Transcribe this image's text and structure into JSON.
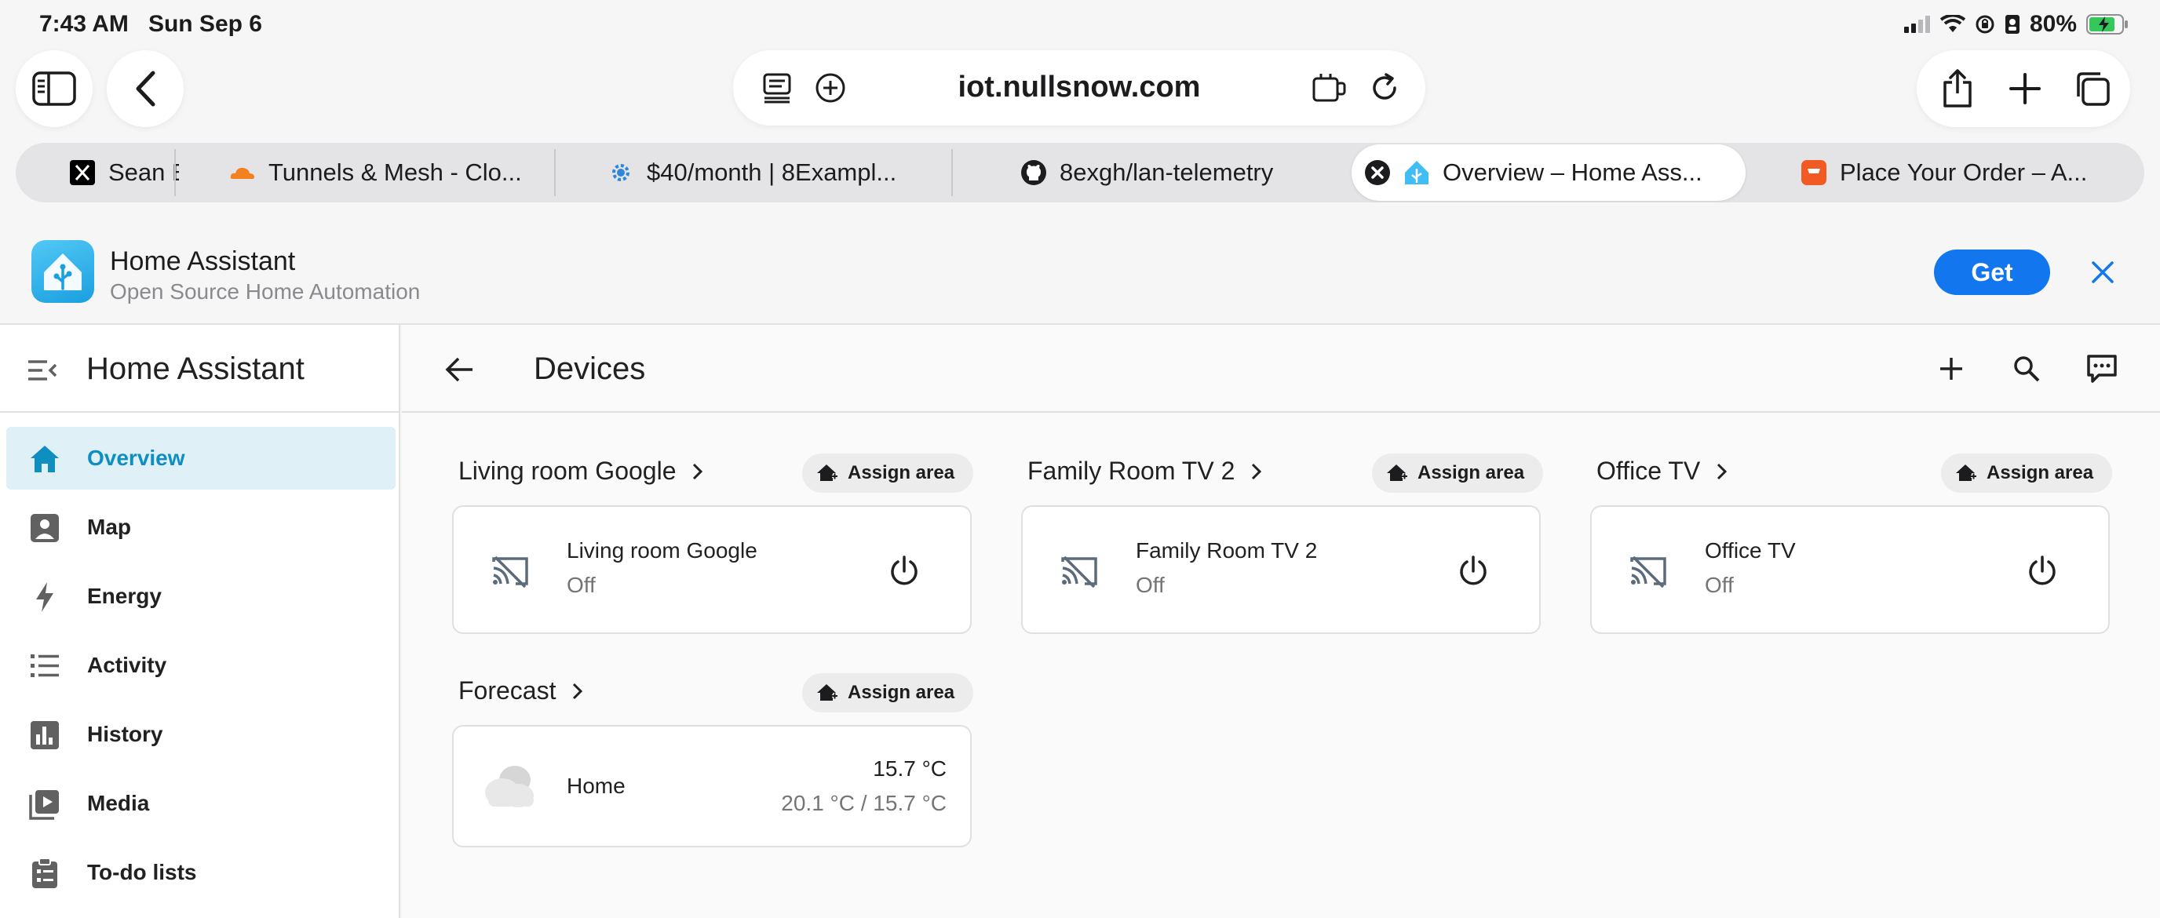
{
  "status_bar": {
    "time": "7:43 AM",
    "date": "Sun Sep 6",
    "battery": "80%"
  },
  "browser": {
    "url": "iot.nullsnow.com",
    "tabs": [
      {
        "title": "Sean E",
        "icon": "x-logo-icon"
      },
      {
        "title": "Tunnels & Mesh - Clo...",
        "icon": "cloudflare-icon"
      },
      {
        "title": "$40/month | 8Exampl...",
        "icon": "gear-icon"
      },
      {
        "title": "8exgh/lan-telemetry",
        "icon": "github-icon"
      },
      {
        "title": "Overview – Home Ass...",
        "icon": "home-assistant-icon",
        "active": true
      },
      {
        "title": "Place Your Order – A...",
        "icon": "store-icon"
      }
    ]
  },
  "app_banner": {
    "title": "Home Assistant",
    "subtitle": "Open Source Home Automation",
    "get_label": "Get"
  },
  "sidebar": {
    "title": "Home Assistant",
    "items": [
      {
        "label": "Overview",
        "icon": "home-icon",
        "selected": true
      },
      {
        "label": "Map",
        "icon": "map-icon"
      },
      {
        "label": "Energy",
        "icon": "lightning-icon"
      },
      {
        "label": "Activity",
        "icon": "list-icon"
      },
      {
        "label": "History",
        "icon": "chart-icon"
      },
      {
        "label": "Media",
        "icon": "media-icon"
      },
      {
        "label": "To-do lists",
        "icon": "clipboard-icon"
      }
    ]
  },
  "main": {
    "title": "Devices",
    "assign_label": "Assign area",
    "groups": [
      {
        "title": "Living room Google",
        "device": "Living room Google",
        "state": "Off"
      },
      {
        "title": "Family Room TV 2",
        "device": "Family Room TV 2",
        "state": "Off"
      },
      {
        "title": "Office TV",
        "device": "Office TV",
        "state": "Off"
      }
    ],
    "forecast": {
      "title": "Forecast",
      "name": "Home",
      "temperature": "15.7 °C",
      "range": "20.1 °C / 15.7 °C"
    }
  },
  "colors": {
    "accent": "#0f8ec2",
    "selected_bg": "#dff0f7",
    "get_button": "#1276ef"
  }
}
